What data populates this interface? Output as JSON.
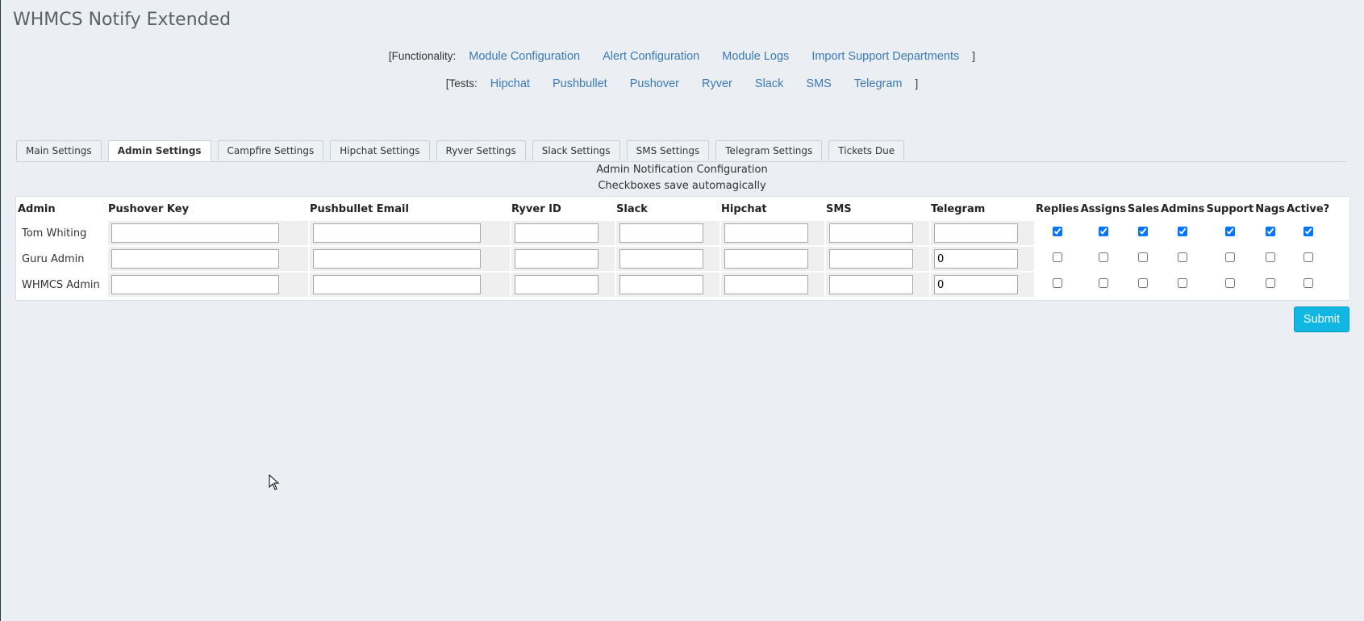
{
  "page": {
    "title": "WHMCS Notify Extended"
  },
  "functionality": {
    "open": "[Functionality:",
    "close": "]",
    "links": [
      "Module Configuration",
      "Alert Configuration",
      "Module Logs",
      "Import Support Departments"
    ]
  },
  "tests": {
    "open": "[Tests:",
    "close": "]",
    "links": [
      "Hipchat",
      "Pushbullet",
      "Pushover",
      "Ryver",
      "Slack",
      "SMS",
      "Telegram"
    ]
  },
  "tabs": [
    "Main Settings",
    "Admin Settings",
    "Campfire Settings",
    "Hipchat Settings",
    "Ryver Settings",
    "Slack Settings",
    "SMS Settings",
    "Telegram Settings",
    "Tickets Due"
  ],
  "active_tab": "Admin Settings",
  "config": {
    "title": "Admin Notification Configuration",
    "note": "Checkboxes save automagically"
  },
  "table": {
    "headers": [
      "Admin",
      "Pushover Key",
      "Pushbullet Email",
      "Ryver ID",
      "Slack",
      "Hipchat",
      "SMS",
      "Telegram",
      "Replies",
      "Assigns",
      "Sales",
      "Admins",
      "Support",
      "Nags",
      "Active?"
    ],
    "rows": [
      {
        "name": "Tom Whiting",
        "pushover": "",
        "pushbullet": "",
        "ryver": "",
        "slack": "",
        "hipchat": "",
        "sms": "",
        "telegram": "",
        "checks": [
          true,
          true,
          true,
          true,
          true,
          true,
          true
        ]
      },
      {
        "name": "Guru Admin",
        "pushover": "",
        "pushbullet": "",
        "ryver": "",
        "slack": "",
        "hipchat": "",
        "sms": "",
        "telegram": "0",
        "checks": [
          false,
          false,
          false,
          false,
          false,
          false,
          false
        ]
      },
      {
        "name": "WHMCS Admin",
        "pushover": "",
        "pushbullet": "",
        "ryver": "",
        "slack": "",
        "hipchat": "",
        "sms": "",
        "telegram": "0",
        "checks": [
          false,
          false,
          false,
          false,
          false,
          false,
          false
        ]
      }
    ]
  },
  "submit_label": "Submit",
  "colors": {
    "accent": "#11b7e3",
    "link": "#3b7ab5",
    "background": "#ebeef2"
  }
}
